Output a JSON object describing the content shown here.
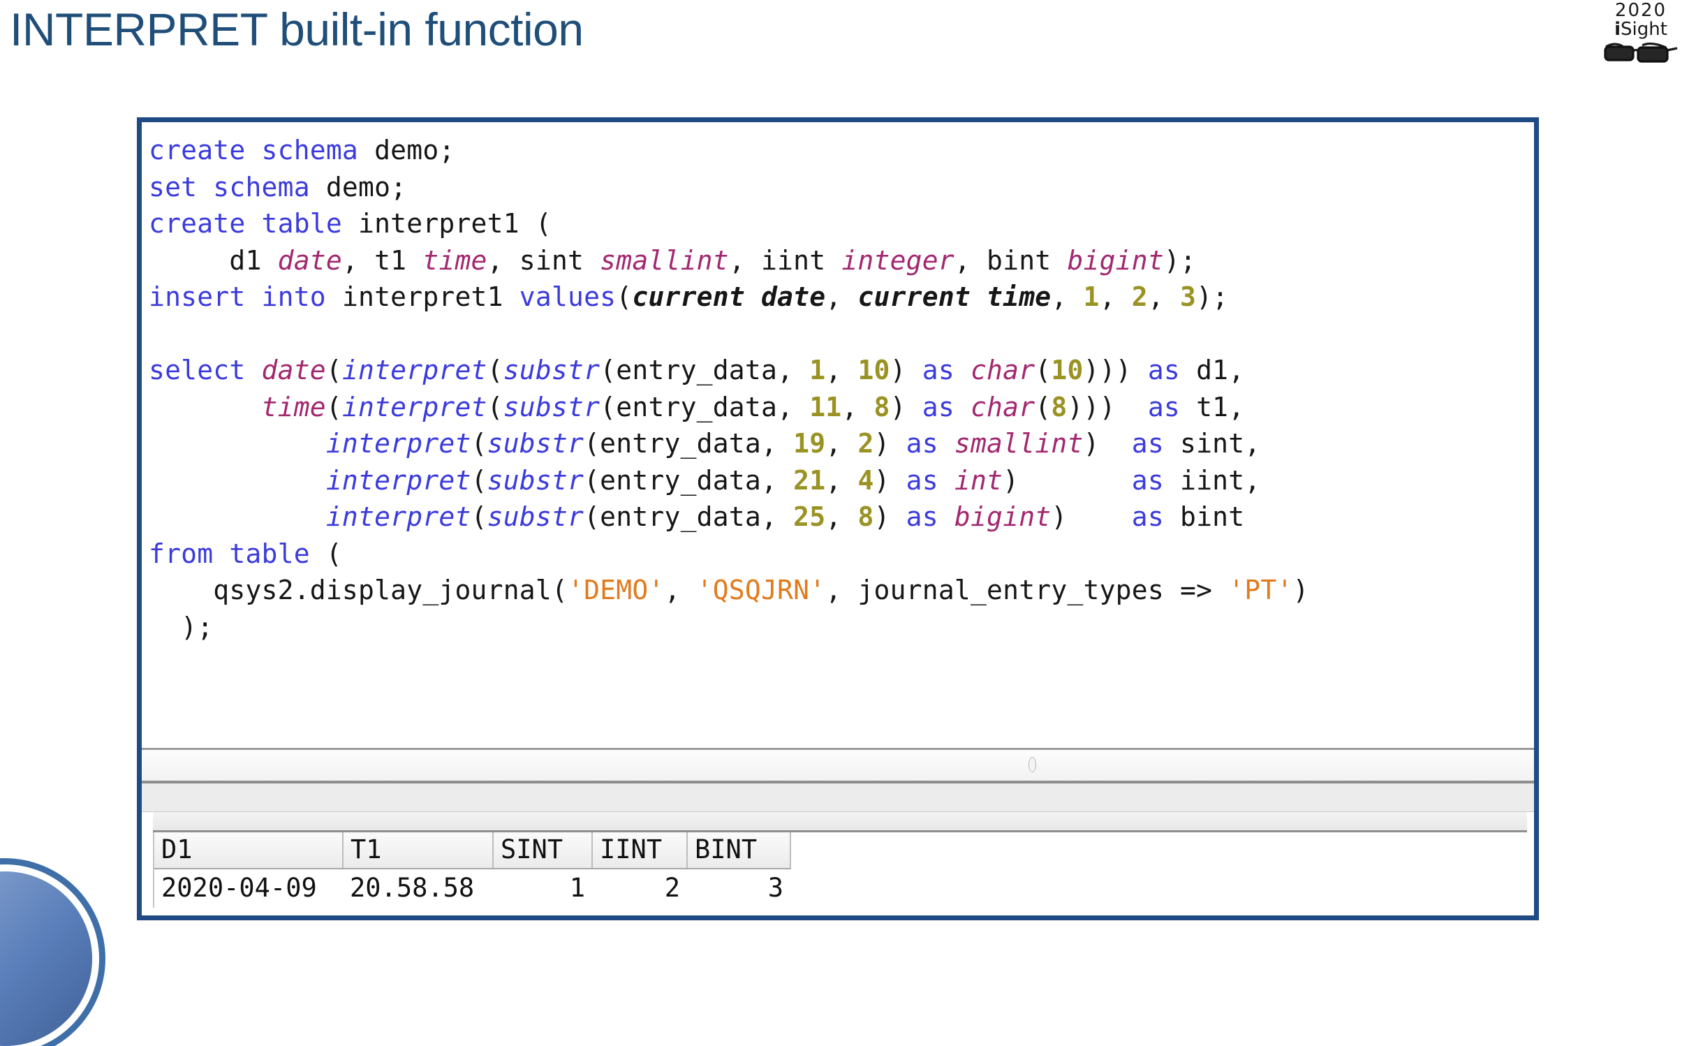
{
  "slide": {
    "title": "INTERPRET built-in function"
  },
  "logo": {
    "year": "2020",
    "name_i": "i",
    "name_rest": "Sight",
    "glasses_icon": "glasses-icon"
  },
  "sql_window": {
    "editor": {
      "lines": [
        [
          {
            "t": "create schema ",
            "c": "kw"
          },
          {
            "t": "demo;",
            "c": "pln"
          }
        ],
        [
          {
            "t": "set schema ",
            "c": "kw"
          },
          {
            "t": "demo;",
            "c": "pln"
          }
        ],
        [
          {
            "t": "create table ",
            "c": "kw"
          },
          {
            "t": "interpret1 (",
            "c": "pln"
          }
        ],
        [
          {
            "t": "     d1 ",
            "c": "pln"
          },
          {
            "t": "date",
            "c": "typ"
          },
          {
            "t": ", t1 ",
            "c": "pln"
          },
          {
            "t": "time",
            "c": "typ"
          },
          {
            "t": ", sint ",
            "c": "pln"
          },
          {
            "t": "smallint",
            "c": "typ"
          },
          {
            "t": ", iint ",
            "c": "pln"
          },
          {
            "t": "integer",
            "c": "typ"
          },
          {
            "t": ", bint ",
            "c": "pln"
          },
          {
            "t": "bigint",
            "c": "typ"
          },
          {
            "t": ");",
            "c": "pln"
          }
        ],
        [
          {
            "t": "insert into ",
            "c": "kw"
          },
          {
            "t": "interpret1 ",
            "c": "pln"
          },
          {
            "t": "values",
            "c": "kw"
          },
          {
            "t": "(",
            "c": "pln"
          },
          {
            "t": "current date",
            "c": "spc"
          },
          {
            "t": ", ",
            "c": "pln"
          },
          {
            "t": "current time",
            "c": "spc"
          },
          {
            "t": ", ",
            "c": "pln"
          },
          {
            "t": "1",
            "c": "num"
          },
          {
            "t": ", ",
            "c": "pln"
          },
          {
            "t": "2",
            "c": "num"
          },
          {
            "t": ", ",
            "c": "pln"
          },
          {
            "t": "3",
            "c": "num"
          },
          {
            "t": ");",
            "c": "pln"
          }
        ],
        [
          {
            "t": "",
            "c": "pln"
          }
        ],
        [
          {
            "t": "select ",
            "c": "kw"
          },
          {
            "t": "date",
            "c": "typ"
          },
          {
            "t": "(",
            "c": "pln"
          },
          {
            "t": "interpret",
            "c": "fn"
          },
          {
            "t": "(",
            "c": "pln"
          },
          {
            "t": "substr",
            "c": "fn"
          },
          {
            "t": "(entry_data, ",
            "c": "pln"
          },
          {
            "t": "1",
            "c": "num"
          },
          {
            "t": ", ",
            "c": "pln"
          },
          {
            "t": "10",
            "c": "num"
          },
          {
            "t": ") ",
            "c": "pln"
          },
          {
            "t": "as ",
            "c": "kw"
          },
          {
            "t": "char",
            "c": "typ"
          },
          {
            "t": "(",
            "c": "pln"
          },
          {
            "t": "10",
            "c": "num"
          },
          {
            "t": "))) ",
            "c": "pln"
          },
          {
            "t": "as ",
            "c": "kw"
          },
          {
            "t": "d1,",
            "c": "pln"
          }
        ],
        [
          {
            "t": "       ",
            "c": "pln"
          },
          {
            "t": "time",
            "c": "typ"
          },
          {
            "t": "(",
            "c": "pln"
          },
          {
            "t": "interpret",
            "c": "fn"
          },
          {
            "t": "(",
            "c": "pln"
          },
          {
            "t": "substr",
            "c": "fn"
          },
          {
            "t": "(entry_data, ",
            "c": "pln"
          },
          {
            "t": "11",
            "c": "num"
          },
          {
            "t": ", ",
            "c": "pln"
          },
          {
            "t": "8",
            "c": "num"
          },
          {
            "t": ") ",
            "c": "pln"
          },
          {
            "t": "as ",
            "c": "kw"
          },
          {
            "t": "char",
            "c": "typ"
          },
          {
            "t": "(",
            "c": "pln"
          },
          {
            "t": "8",
            "c": "num"
          },
          {
            "t": ")))  ",
            "c": "pln"
          },
          {
            "t": "as ",
            "c": "kw"
          },
          {
            "t": "t1,",
            "c": "pln"
          }
        ],
        [
          {
            "t": "           ",
            "c": "pln"
          },
          {
            "t": "interpret",
            "c": "fn"
          },
          {
            "t": "(",
            "c": "pln"
          },
          {
            "t": "substr",
            "c": "fn"
          },
          {
            "t": "(entry_data, ",
            "c": "pln"
          },
          {
            "t": "19",
            "c": "num"
          },
          {
            "t": ", ",
            "c": "pln"
          },
          {
            "t": "2",
            "c": "num"
          },
          {
            "t": ") ",
            "c": "pln"
          },
          {
            "t": "as ",
            "c": "kw"
          },
          {
            "t": "smallint",
            "c": "typ"
          },
          {
            "t": ")  ",
            "c": "pln"
          },
          {
            "t": "as ",
            "c": "kw"
          },
          {
            "t": "sint,",
            "c": "pln"
          }
        ],
        [
          {
            "t": "           ",
            "c": "pln"
          },
          {
            "t": "interpret",
            "c": "fn"
          },
          {
            "t": "(",
            "c": "pln"
          },
          {
            "t": "substr",
            "c": "fn"
          },
          {
            "t": "(entry_data, ",
            "c": "pln"
          },
          {
            "t": "21",
            "c": "num"
          },
          {
            "t": ", ",
            "c": "pln"
          },
          {
            "t": "4",
            "c": "num"
          },
          {
            "t": ") ",
            "c": "pln"
          },
          {
            "t": "as ",
            "c": "kw"
          },
          {
            "t": "int",
            "c": "typ"
          },
          {
            "t": ")       ",
            "c": "pln"
          },
          {
            "t": "as ",
            "c": "kw"
          },
          {
            "t": "iint,",
            "c": "pln"
          }
        ],
        [
          {
            "t": "           ",
            "c": "pln"
          },
          {
            "t": "interpret",
            "c": "fn"
          },
          {
            "t": "(",
            "c": "pln"
          },
          {
            "t": "substr",
            "c": "fn"
          },
          {
            "t": "(entry_data, ",
            "c": "pln"
          },
          {
            "t": "25",
            "c": "num"
          },
          {
            "t": ", ",
            "c": "pln"
          },
          {
            "t": "8",
            "c": "num"
          },
          {
            "t": ") ",
            "c": "pln"
          },
          {
            "t": "as ",
            "c": "kw"
          },
          {
            "t": "bigint",
            "c": "typ"
          },
          {
            "t": ")    ",
            "c": "pln"
          },
          {
            "t": "as ",
            "c": "kw"
          },
          {
            "t": "bint",
            "c": "pln"
          }
        ],
        [
          {
            "t": "from table ",
            "c": "kw"
          },
          {
            "t": "(",
            "c": "pln"
          }
        ],
        [
          {
            "t": "    qsys2.display_journal(",
            "c": "pln"
          },
          {
            "t": "'DEMO'",
            "c": "str"
          },
          {
            "t": ", ",
            "c": "pln"
          },
          {
            "t": "'QSQJRN'",
            "c": "str"
          },
          {
            "t": ", journal_entry_types => ",
            "c": "pln"
          },
          {
            "t": "'PT'",
            "c": "str"
          },
          {
            "t": ")",
            "c": "pln"
          }
        ],
        [
          {
            "t": "  );",
            "c": "pln"
          }
        ]
      ]
    },
    "results": {
      "columns": [
        "D1",
        "T1",
        "SINT",
        "IINT",
        "BINT"
      ],
      "rows": [
        [
          "2020-04-09",
          "20.58.58",
          "1",
          "2",
          "3"
        ]
      ]
    }
  },
  "colors": {
    "title": "#1f4e79",
    "frame_border": "#204a83",
    "keyword": "#3b3bdd",
    "datatype": "#a32870",
    "function": "#3b3bdd",
    "number": "#9a9223",
    "string": "#e07b1e",
    "plain": "#161616"
  }
}
